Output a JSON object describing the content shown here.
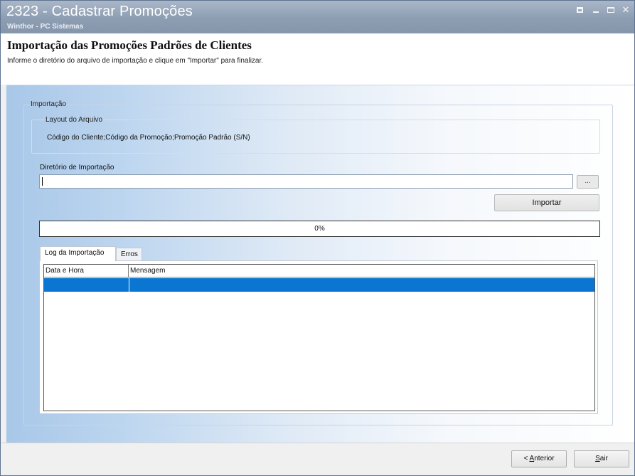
{
  "window": {
    "title": "2323 - Cadastrar Promoções",
    "subtitle": "Winthor - PC Sistemas"
  },
  "header": {
    "title": "Importação das Promoções Padrões de Clientes",
    "instructions": "Informe o diretório do arquivo de importação e clique em \"Importar\" para finalizar."
  },
  "importacao": {
    "legend": "Importação",
    "layout": {
      "legend": "Layout do Arquivo",
      "text": "Código do Cliente;Código da Promoção;Promoção Padrão (S/N)"
    },
    "diretorio": {
      "label": "Diretório de Importação",
      "value": "",
      "browse_label": "..."
    },
    "import_button": "Importar",
    "progress": {
      "value": 0,
      "label": "0%"
    }
  },
  "tabs": [
    {
      "label": "Log da Importação",
      "active": true
    },
    {
      "label": "Erros",
      "active": false
    }
  ],
  "grid": {
    "columns": [
      "Data e Hora",
      "Mensagem"
    ],
    "rows": [
      {
        "data_hora": "",
        "mensagem": "",
        "selected": true
      }
    ]
  },
  "footer": {
    "anterior_prefix": "< ",
    "anterior_mnemonic": "A",
    "anterior_rest": "nterior",
    "sair_mnemonic": "S",
    "sair_rest": "air"
  },
  "colors": {
    "titlebar": "#8d9db2",
    "selection": "#0a76d2",
    "gradient_left": "#a8c7e8"
  }
}
